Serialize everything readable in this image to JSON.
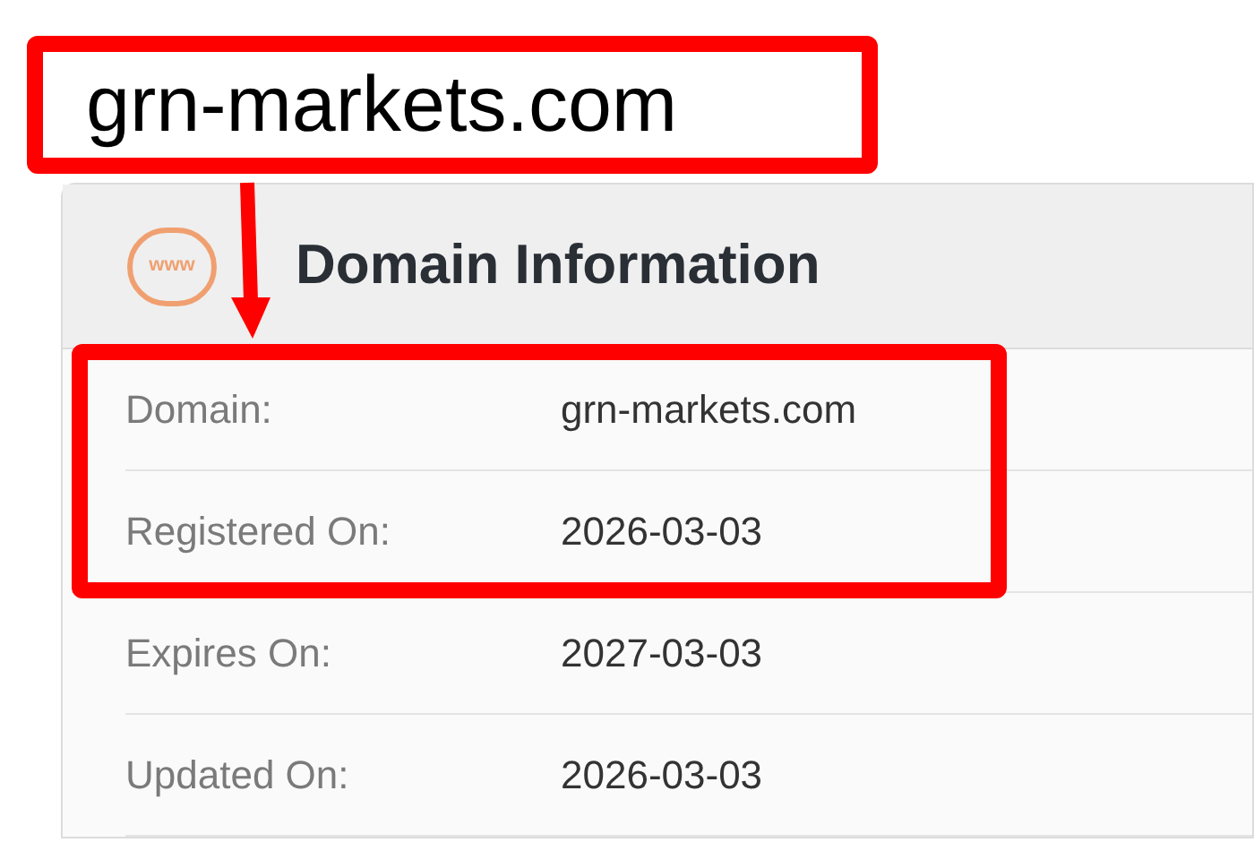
{
  "page_title": "grn-markets.com",
  "card": {
    "icon_text": "www",
    "title": "Domain Information",
    "rows": [
      {
        "label": "Domain:",
        "value": "grn-markets.com"
      },
      {
        "label": "Registered On:",
        "value": "2026-03-03"
      },
      {
        "label": "Expires On:",
        "value": "2027-03-03"
      },
      {
        "label": "Updated On:",
        "value": "2026-03-03"
      }
    ]
  }
}
